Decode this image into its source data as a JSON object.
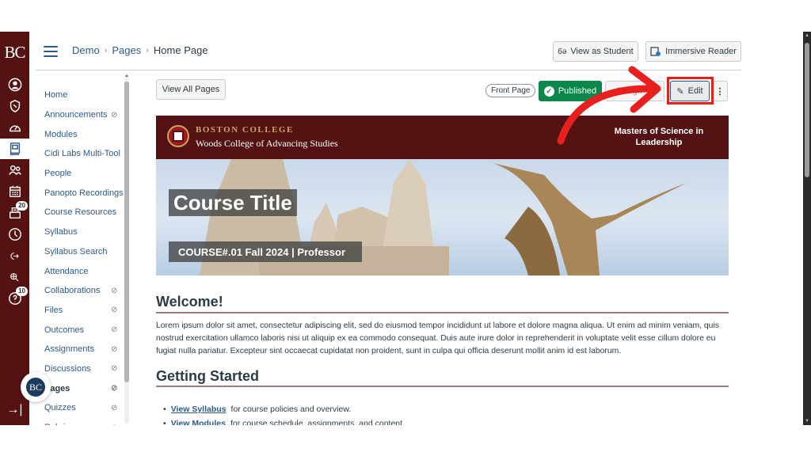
{
  "global_nav": {
    "logo": "BC",
    "items": [
      {
        "name": "account",
        "icon": "user-circle-icon"
      },
      {
        "name": "admin",
        "icon": "shield-icon"
      },
      {
        "name": "dashboard",
        "icon": "speedometer-icon"
      },
      {
        "name": "courses",
        "icon": "book-icon",
        "active": true
      },
      {
        "name": "groups",
        "icon": "people-icon"
      },
      {
        "name": "calendar",
        "icon": "calendar-icon"
      },
      {
        "name": "inbox",
        "icon": "inbox-icon",
        "badge": "20"
      },
      {
        "name": "history",
        "icon": "clock-icon"
      },
      {
        "name": "external-tool",
        "icon": "arrow-out-icon"
      },
      {
        "name": "search",
        "icon": "globe-search-icon"
      },
      {
        "name": "help",
        "icon": "help-icon",
        "badge": "10"
      }
    ],
    "collapse_glyph": "→|"
  },
  "header": {
    "breadcrumb": [
      "Demo",
      "Pages",
      "Home Page"
    ],
    "view_as_student": "View as Student",
    "immersive_reader": "Immersive Reader"
  },
  "course_nav": {
    "items": [
      {
        "label": "Home",
        "hidden": false
      },
      {
        "label": "Announcements",
        "hidden": true
      },
      {
        "label": "Modules",
        "hidden": false
      },
      {
        "label": "Cidi Labs Multi-Tool",
        "hidden": false
      },
      {
        "label": "People",
        "hidden": false
      },
      {
        "label": "Panopto Recordings",
        "hidden": false
      },
      {
        "label": "Course Resources",
        "hidden": false
      },
      {
        "label": "Syllabus",
        "hidden": false
      },
      {
        "label": "Syllabus Search",
        "hidden": false
      },
      {
        "label": "Attendance",
        "hidden": false
      },
      {
        "label": "Collaborations",
        "hidden": true
      },
      {
        "label": "Files",
        "hidden": true
      },
      {
        "label": "Outcomes",
        "hidden": true
      },
      {
        "label": "Assignments",
        "hidden": true
      },
      {
        "label": "Discussions",
        "hidden": true
      },
      {
        "label": "Pages",
        "hidden": true,
        "active": true
      },
      {
        "label": "Quizzes",
        "hidden": true
      },
      {
        "label": "Rubrics",
        "hidden": true
      }
    ],
    "avatar_initials": "BC"
  },
  "toolbar": {
    "view_all_pages": "View All Pages",
    "front_page": "Front Page",
    "published": "Published",
    "assign_to": "Assign To",
    "edit": "Edit",
    "more": "⋮"
  },
  "banner": {
    "institution": "BOSTON COLLEGE",
    "school": "Woods College of Advancing Studies",
    "program": "Masters of Science in Leadership",
    "course_title": "Course Title",
    "course_subtitle": "COURSE#.01 Fall 2024 | Professor"
  },
  "content": {
    "welcome_heading": "Welcome!",
    "welcome_text": "Lorem ipsum dolor sit amet, consectetur adipiscing elit, sed do eiusmod tempor incididunt ut labore et dolore magna aliqua. Ut enim ad minim veniam, quis nostrud exercitation ullamco laboris nisi ut aliquip ex ea commodo consequat. Duis aute irure dolor in reprehenderit in voluptate velit esse cillum dolore eu fugiat nulla pariatur. Excepteur sint occaecat cupidatat non proident, sunt in culpa qui officia deserunt mollit anim id est laborum.",
    "getting_started_heading": "Getting Started",
    "getting_started_items": [
      {
        "link": "View Syllabus",
        "text": "for course policies and overview."
      },
      {
        "link": "View Modules",
        "text": "for course schedule, assignments, and content."
      }
    ]
  },
  "annotation": {
    "color": "#e8201d",
    "target": "Edit"
  },
  "colors": {
    "brand": "#541212",
    "link": "#2d5a8c",
    "published": "#0b874b",
    "gold": "#c9a85a"
  }
}
